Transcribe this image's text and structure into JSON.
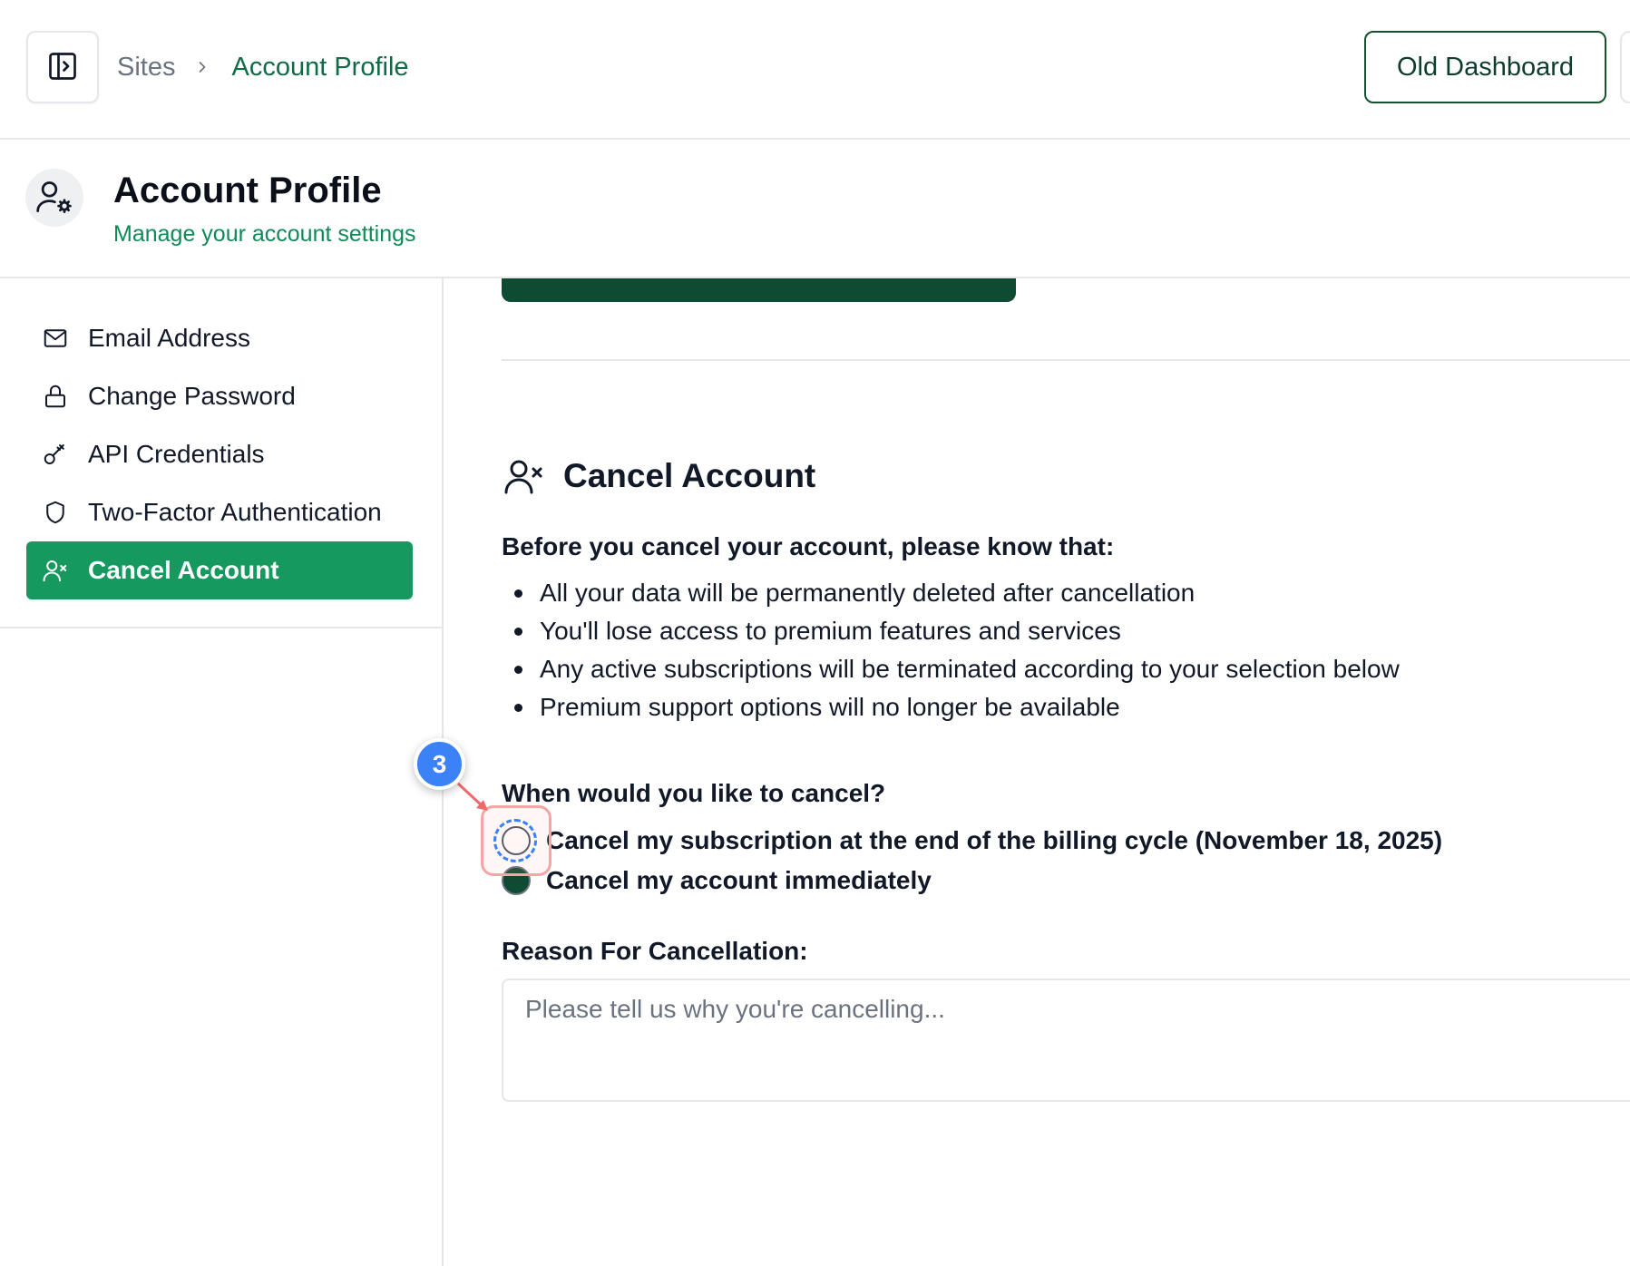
{
  "breadcrumb": {
    "parent": "Sites",
    "current": "Account Profile"
  },
  "topbar": {
    "old_dashboard_label": "Old Dashboard"
  },
  "header": {
    "title": "Account Profile",
    "subtitle": "Manage your account settings"
  },
  "sidebar": {
    "items": [
      {
        "label": "Email Address",
        "icon": "mail-icon",
        "active": false
      },
      {
        "label": "Change Password",
        "icon": "lock-icon",
        "active": false
      },
      {
        "label": "API Credentials",
        "icon": "key-icon",
        "active": false
      },
      {
        "label": "Two-Factor Authentication",
        "icon": "shield-icon",
        "active": false
      },
      {
        "label": "Cancel Account",
        "icon": "user-x-icon",
        "active": true
      }
    ]
  },
  "cancel": {
    "title": "Cancel Account",
    "intro": "Before you cancel your account, please know that:",
    "bullets": [
      "All your data will be permanently deleted after cancellation",
      "You'll lose access to premium features and services",
      "Any active subscriptions will be terminated according to your selection below",
      "Premium support options will no longer be available"
    ],
    "question": "When would you like to cancel?",
    "options": [
      {
        "label": "Cancel my subscription at the end of the billing cycle (November 18, 2025)",
        "selected": false
      },
      {
        "label": "Cancel my account immediately",
        "selected": true
      }
    ],
    "reason_label": "Reason For Cancellation:",
    "reason_placeholder": "Please tell us why you're cancelling..."
  },
  "annotation": {
    "step": "3"
  },
  "colors": {
    "accent_green": "#15995f",
    "dark_green": "#0f4a32",
    "breadcrumb_green": "#0f6b46",
    "annotation_blue": "#3b82f6",
    "annotation_red": "#ef4444"
  }
}
